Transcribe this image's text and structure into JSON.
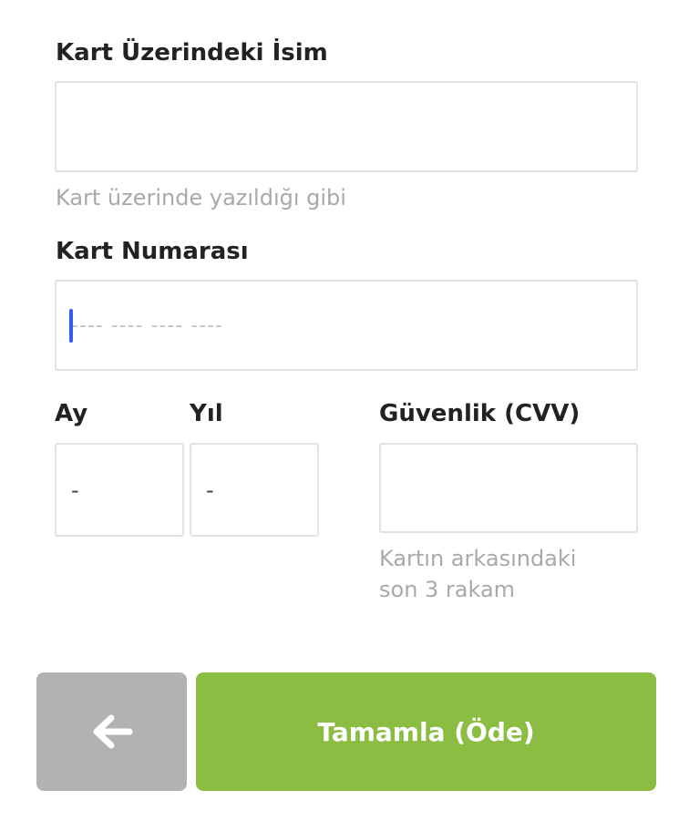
{
  "name_section": {
    "label": "Kart Üzerindeki İsim",
    "value": "",
    "hint": "Kart üzerinde yazıldığı gibi"
  },
  "number_section": {
    "label": "Kart Numarası",
    "placeholder": "---- ---- ---- ----",
    "value": ""
  },
  "month_section": {
    "label": "Ay",
    "selected": "-"
  },
  "year_section": {
    "label": "Yıl",
    "selected": "-"
  },
  "cvv_section": {
    "label": "Güvenlik (CVV)",
    "value": "",
    "hint_line1": "Kartın arkasındaki",
    "hint_line2": "son 3 rakam"
  },
  "actions": {
    "back_icon": "arrow-left-icon",
    "submit_label": "Tamamla (Öde)"
  },
  "colors": {
    "submit": "#8bbd42",
    "back": "#b2b2b2",
    "caret": "#3a5bf0"
  }
}
